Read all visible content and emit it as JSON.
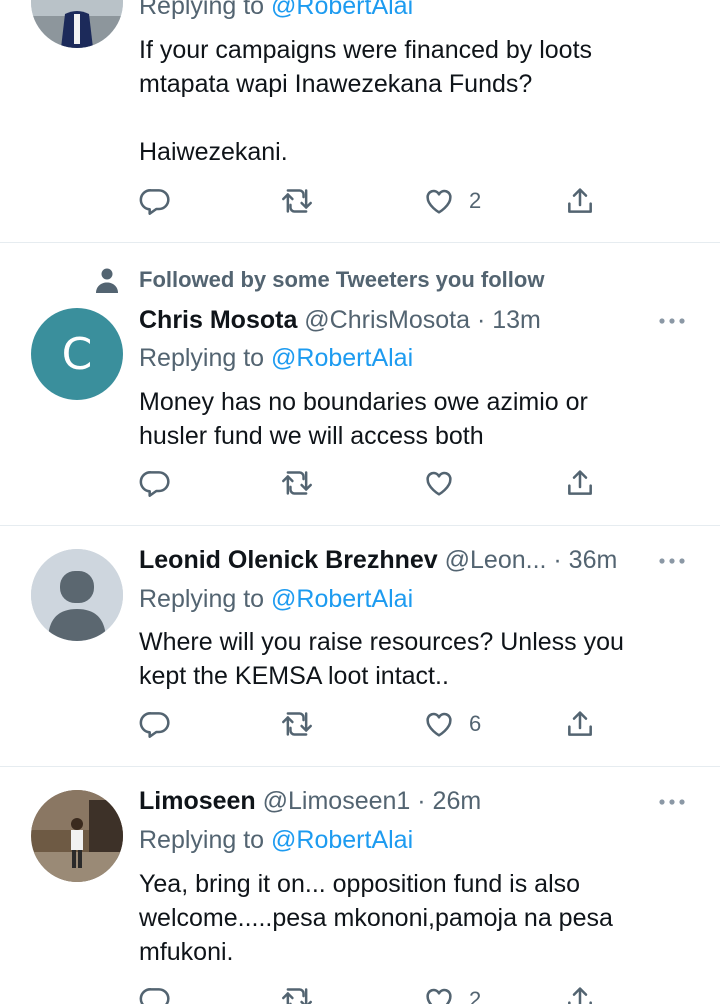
{
  "tweets": [
    {
      "reply_prefix": "Replying to ",
      "reply_handle": "@RobertAlai",
      "body": "If your campaigns were financed by loots\nmtapata wapi Inawezekana Funds?\n\nHaiwezekani.",
      "likes": "2"
    },
    {
      "social_context": "Followed by some Tweeters you follow",
      "avatar_letter": "C",
      "avatar_color": "#3a8f9c",
      "display_name": "Chris Mosota",
      "meta": " @ChrisMosota · 13m",
      "reply_prefix": "Replying to ",
      "reply_handle": "@RobertAlai",
      "body": "Money has no boundaries owe azimio or\nhusler fund we will access both",
      "likes": ""
    },
    {
      "display_name": "Leonid Olenick Brezhnev",
      "meta": " @Leon... · 36m",
      "reply_prefix": "Replying to ",
      "reply_handle": "@RobertAlai",
      "body": "Where will you raise resources? Unless you\nkept the KEMSA loot intact..",
      "likes": "6"
    },
    {
      "display_name": "Limoseen",
      "meta": " @Limoseen1 · 26m",
      "reply_prefix": "Replying to ",
      "reply_handle": "@RobertAlai",
      "body": "Yea, bring it on... opposition fund is also\nwelcome.....pesa mkononi,pamoja na pesa\nmfukoni.",
      "likes": "2"
    }
  ],
  "colors": {
    "link": "#1d9bf0",
    "secondary_text": "#536471",
    "divider": "#e6ecf0",
    "icon": "#536471"
  },
  "icons": [
    "reply-icon",
    "retweet-icon",
    "like-icon",
    "share-icon",
    "more-icon",
    "person-icon"
  ]
}
